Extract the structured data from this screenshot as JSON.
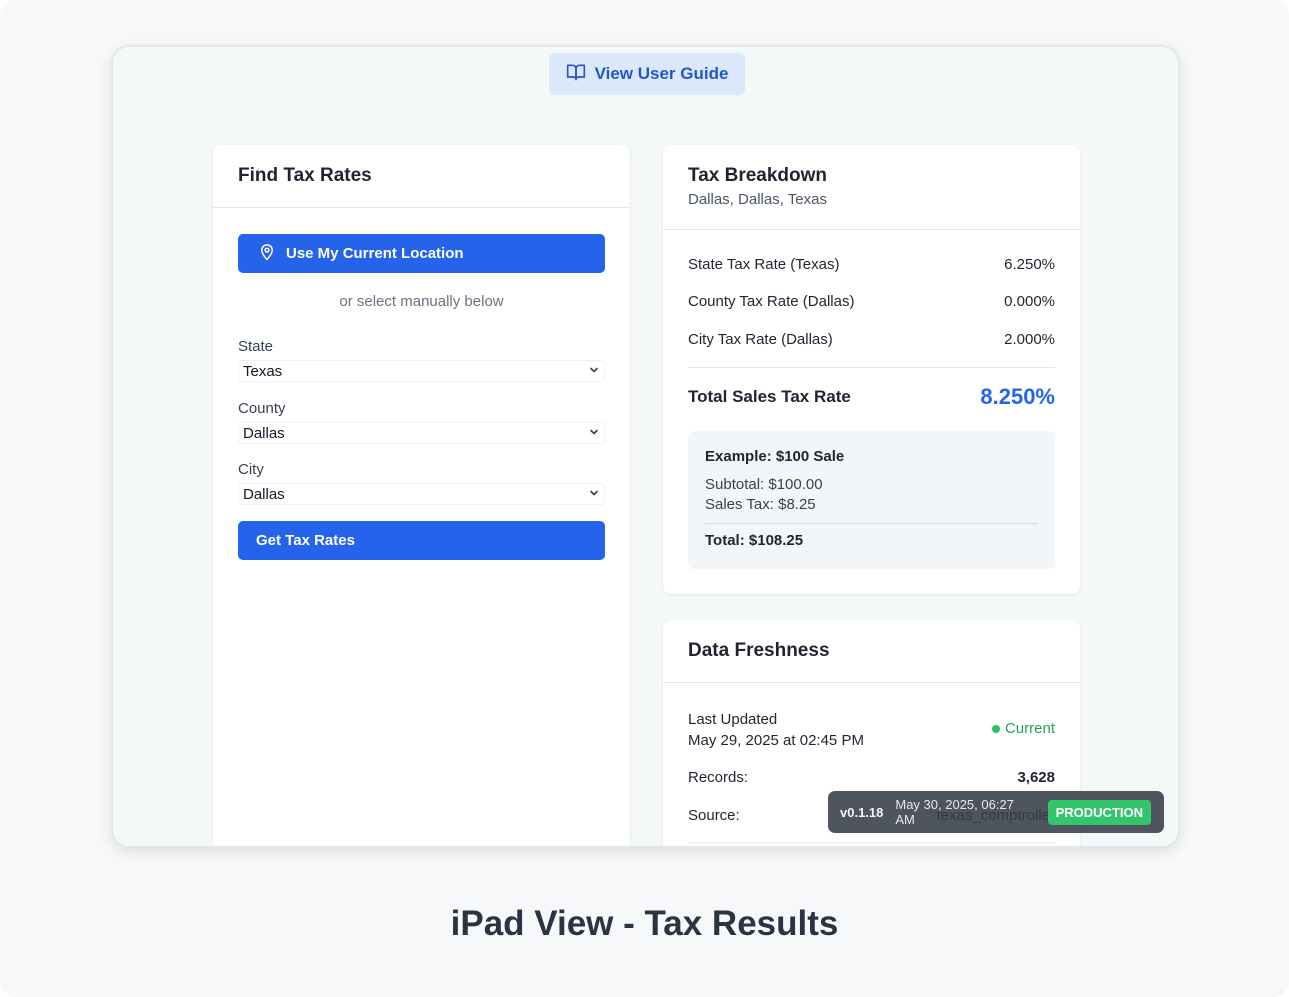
{
  "guide_button": {
    "label": "View User Guide"
  },
  "find": {
    "title": "Find Tax Rates",
    "location_button": "Use My Current Location",
    "manual_text": "or select manually below",
    "state_label": "State",
    "state_value": "Texas",
    "county_label": "County",
    "county_value": "Dallas",
    "city_label": "City",
    "city_value": "Dallas",
    "submit_button": "Get Tax Rates"
  },
  "breakdown": {
    "title": "Tax Breakdown",
    "location": "Dallas, Dallas, Texas",
    "rows": [
      {
        "label": "State Tax Rate (Texas)",
        "value": "6.250%"
      },
      {
        "label": "County Tax Rate (Dallas)",
        "value": "0.000%"
      },
      {
        "label": "City Tax Rate (Dallas)",
        "value": "2.000%"
      }
    ],
    "total_label": "Total Sales Tax Rate",
    "total_value": "8.250%",
    "example": {
      "title": "Example: $100 Sale",
      "subtotal": "Subtotal: $100.00",
      "sales_tax": "Sales Tax: $8.25",
      "total": "Total: $108.25"
    }
  },
  "freshness": {
    "title": "Data Freshness",
    "last_updated_label": "Last Updated",
    "last_updated_value": "May 29, 2025 at 02:45 PM",
    "status": "Current",
    "records_label": "Records:",
    "records_value": "3,628",
    "source_label": "Source:",
    "source_value": "texas_comptroller"
  },
  "version_badge": {
    "version": "v0.1.18",
    "timestamp": "May 30, 2025, 06:27 AM",
    "environment": "PRODUCTION"
  },
  "caption": "iPad View - Tax Results",
  "colors": {
    "primary": "#2563eb",
    "status_green": "#22c55e",
    "production_green": "#34c56b"
  }
}
